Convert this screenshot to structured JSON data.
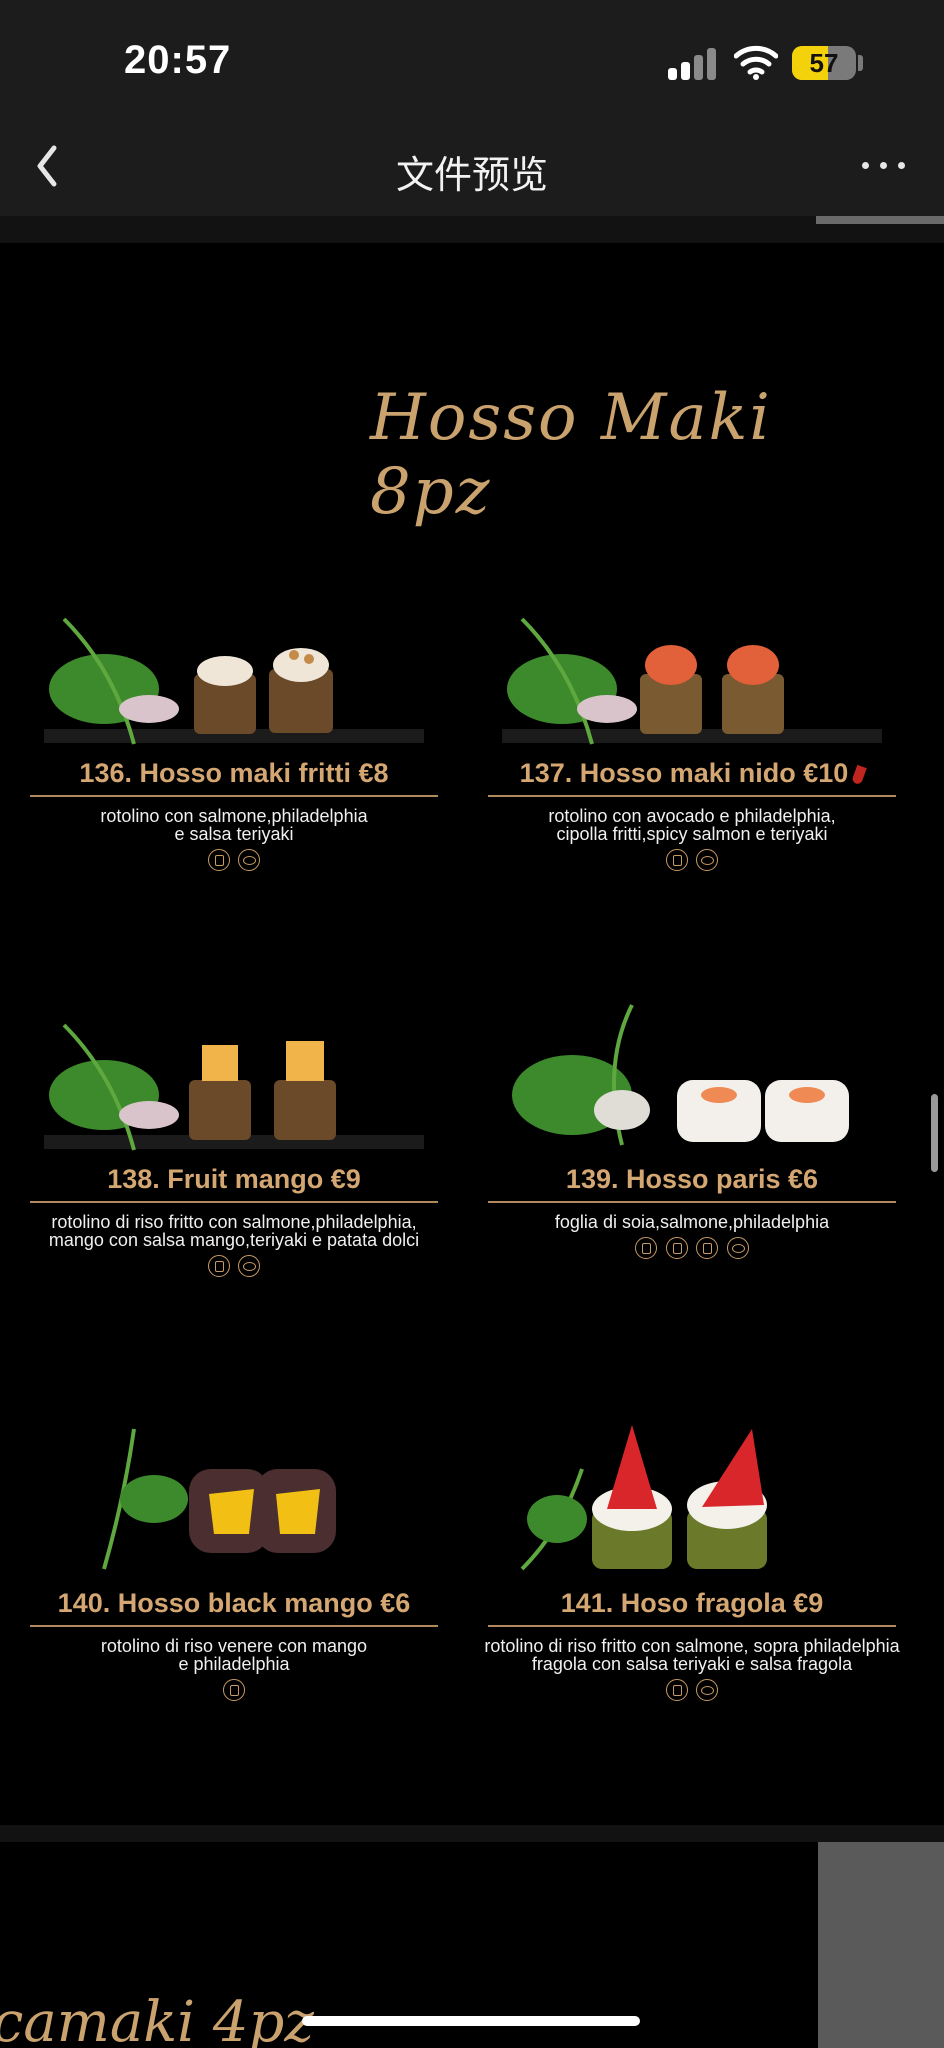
{
  "status_bar": {
    "time": "20:57",
    "battery": "57"
  },
  "nav": {
    "title": "文件预览"
  },
  "menu": {
    "section_title": "Hosso Maki 8pz",
    "next_section_title_partial": "camaki 4pz",
    "items": [
      {
        "title": "136. Hosso maki fritti €8",
        "desc": "rotolino con salmone,philadelphia\ne salsa teriyaki",
        "allergens": [
          "gluten-icon",
          "fish-icon"
        ]
      },
      {
        "title": "137. Hosso maki nido €10",
        "desc": "rotolino con avocado e philadelphia,\ncipolla fritti,spicy salmon e teriyaki",
        "allergens": [
          "gluten-icon",
          "fish-icon"
        ],
        "spicy": true
      },
      {
        "title": "138. Fruit mango €9",
        "desc": "rotolino di riso fritto con salmone,philadelphia,\nmango con salsa mango,teriyaki e patata dolci",
        "allergens": [
          "gluten-icon",
          "fish-icon"
        ]
      },
      {
        "title": "139. Hosso paris €6",
        "desc": "foglia di soia,salmone,philadelphia",
        "allergens": [
          "soy-icon",
          "gluten-icon",
          "crustacean-icon",
          "fish-icon"
        ]
      },
      {
        "title": "140. Hosso black mango €6",
        "desc": "rotolino di riso venere con mango\ne philadelphia",
        "allergens": [
          "gluten-icon"
        ]
      },
      {
        "title": "141. Hoso fragola €9",
        "desc": "rotolino di riso fritto con salmone, sopra philadelphia\nfragola con salsa teriyaki e salsa fragola",
        "allergens": [
          "gluten-icon",
          "fish-icon"
        ]
      }
    ]
  },
  "colors": {
    "gold": "#caa26e",
    "background": "#000000",
    "toolbar": "#1c1c1c"
  }
}
